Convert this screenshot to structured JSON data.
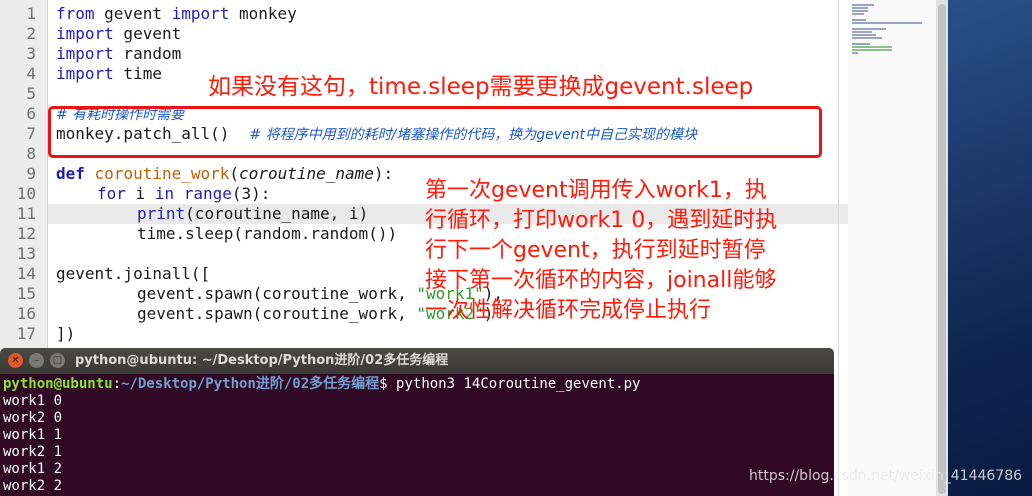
{
  "editor": {
    "line_numbers": [
      "1",
      "2",
      "3",
      "4",
      "5",
      "6",
      "7",
      "8",
      "9",
      "10",
      "11",
      "12",
      "13",
      "14",
      "15",
      "16",
      "17"
    ],
    "lines": {
      "l1": {
        "kw1": "from",
        "mod": " gevent ",
        "kw2": "import",
        "rest": " monkey"
      },
      "l2": {
        "kw": "import",
        "rest": " gevent"
      },
      "l3": {
        "kw": "import",
        "rest": " random"
      },
      "l4": {
        "kw": "import",
        "rest": " time"
      },
      "l6": {
        "comment": "# 有耗时操作时需要"
      },
      "l7": {
        "code": "monkey.patch_all()",
        "comment": "# 将程序中用到的耗时/堵塞操作的代码，换为gevent中自己实现的模块"
      },
      "l9": {
        "kw": "def",
        "fn": "coroutine_work",
        "p1": "(",
        "param": "coroutine_name",
        "p2": "):"
      },
      "l10": {
        "kw1": "for",
        "mid1": " i ",
        "kw2": "in",
        "mid2": " ",
        "bi": "range",
        "rest": "(3):"
      },
      "l11": {
        "bi": "print",
        "rest": "(coroutine_name, i)"
      },
      "l12": {
        "code": "time.sleep(random.random())"
      },
      "l14": {
        "code": "gevent.joinall(["
      },
      "l15": {
        "code": "gevent.spawn(coroutine_work, ",
        "str": "\"work1\"",
        "tail": "),"
      },
      "l16": {
        "code": "gevent.spawn(coroutine_work, ",
        "str": "\"work2\"",
        "tail": ")"
      },
      "l17": {
        "code": "])"
      }
    }
  },
  "annotations": {
    "top": "如果没有这句，time.sleep需要更换成gevent.sleep",
    "explain_1": "第一次gevent调用传入work1，执",
    "explain_2": "行循环，打印work1 0，遇到延时执",
    "explain_3": "行下一个gevent，执行到延时暂停",
    "explain_4": "接下第一次循环的内容，joinall能够",
    "explain_5": "一次性解决循环完成停止执行"
  },
  "terminal": {
    "title": "python@ubuntu: ~/Desktop/Python进阶/02多任务编程",
    "prompt_user": "python@ubuntu",
    "prompt_path": "~/Desktop/Python进阶/02多任务编程",
    "command": "$ python3 14Coroutine_gevent.py",
    "output": [
      "work1 0",
      "work2 0",
      "work1 1",
      "work2 1",
      "work1 2",
      "work2 2"
    ]
  },
  "watermark": "https://blog.csdn.net/weixin_41446786",
  "colors": {
    "keyword": "#1f1faf",
    "function": "#b8620a",
    "comment": "#1d58c7",
    "string": "#2c9c2c",
    "annotation": "#ff1a0a",
    "terminal_bg": "#300a24"
  },
  "icons": {
    "close": "close-icon",
    "minimize": "minimize-icon",
    "maximize": "maximize-icon"
  }
}
